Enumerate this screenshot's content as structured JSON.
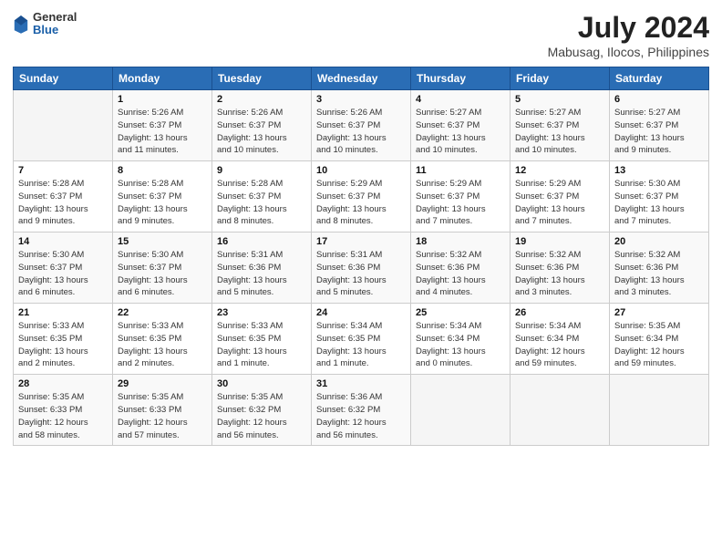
{
  "header": {
    "logo_general": "General",
    "logo_blue": "Blue",
    "month_year": "July 2024",
    "location": "Mabusag, Ilocos, Philippines"
  },
  "calendar": {
    "days_of_week": [
      "Sunday",
      "Monday",
      "Tuesday",
      "Wednesday",
      "Thursday",
      "Friday",
      "Saturday"
    ],
    "weeks": [
      [
        {
          "day": "",
          "info": ""
        },
        {
          "day": "1",
          "info": "Sunrise: 5:26 AM\nSunset: 6:37 PM\nDaylight: 13 hours\nand 11 minutes."
        },
        {
          "day": "2",
          "info": "Sunrise: 5:26 AM\nSunset: 6:37 PM\nDaylight: 13 hours\nand 10 minutes."
        },
        {
          "day": "3",
          "info": "Sunrise: 5:26 AM\nSunset: 6:37 PM\nDaylight: 13 hours\nand 10 minutes."
        },
        {
          "day": "4",
          "info": "Sunrise: 5:27 AM\nSunset: 6:37 PM\nDaylight: 13 hours\nand 10 minutes."
        },
        {
          "day": "5",
          "info": "Sunrise: 5:27 AM\nSunset: 6:37 PM\nDaylight: 13 hours\nand 10 minutes."
        },
        {
          "day": "6",
          "info": "Sunrise: 5:27 AM\nSunset: 6:37 PM\nDaylight: 13 hours\nand 9 minutes."
        }
      ],
      [
        {
          "day": "7",
          "info": "Sunrise: 5:28 AM\nSunset: 6:37 PM\nDaylight: 13 hours\nand 9 minutes."
        },
        {
          "day": "8",
          "info": "Sunrise: 5:28 AM\nSunset: 6:37 PM\nDaylight: 13 hours\nand 9 minutes."
        },
        {
          "day": "9",
          "info": "Sunrise: 5:28 AM\nSunset: 6:37 PM\nDaylight: 13 hours\nand 8 minutes."
        },
        {
          "day": "10",
          "info": "Sunrise: 5:29 AM\nSunset: 6:37 PM\nDaylight: 13 hours\nand 8 minutes."
        },
        {
          "day": "11",
          "info": "Sunrise: 5:29 AM\nSunset: 6:37 PM\nDaylight: 13 hours\nand 7 minutes."
        },
        {
          "day": "12",
          "info": "Sunrise: 5:29 AM\nSunset: 6:37 PM\nDaylight: 13 hours\nand 7 minutes."
        },
        {
          "day": "13",
          "info": "Sunrise: 5:30 AM\nSunset: 6:37 PM\nDaylight: 13 hours\nand 7 minutes."
        }
      ],
      [
        {
          "day": "14",
          "info": "Sunrise: 5:30 AM\nSunset: 6:37 PM\nDaylight: 13 hours\nand 6 minutes."
        },
        {
          "day": "15",
          "info": "Sunrise: 5:30 AM\nSunset: 6:37 PM\nDaylight: 13 hours\nand 6 minutes."
        },
        {
          "day": "16",
          "info": "Sunrise: 5:31 AM\nSunset: 6:36 PM\nDaylight: 13 hours\nand 5 minutes."
        },
        {
          "day": "17",
          "info": "Sunrise: 5:31 AM\nSunset: 6:36 PM\nDaylight: 13 hours\nand 5 minutes."
        },
        {
          "day": "18",
          "info": "Sunrise: 5:32 AM\nSunset: 6:36 PM\nDaylight: 13 hours\nand 4 minutes."
        },
        {
          "day": "19",
          "info": "Sunrise: 5:32 AM\nSunset: 6:36 PM\nDaylight: 13 hours\nand 3 minutes."
        },
        {
          "day": "20",
          "info": "Sunrise: 5:32 AM\nSunset: 6:36 PM\nDaylight: 13 hours\nand 3 minutes."
        }
      ],
      [
        {
          "day": "21",
          "info": "Sunrise: 5:33 AM\nSunset: 6:35 PM\nDaylight: 13 hours\nand 2 minutes."
        },
        {
          "day": "22",
          "info": "Sunrise: 5:33 AM\nSunset: 6:35 PM\nDaylight: 13 hours\nand 2 minutes."
        },
        {
          "day": "23",
          "info": "Sunrise: 5:33 AM\nSunset: 6:35 PM\nDaylight: 13 hours\nand 1 minute."
        },
        {
          "day": "24",
          "info": "Sunrise: 5:34 AM\nSunset: 6:35 PM\nDaylight: 13 hours\nand 1 minute."
        },
        {
          "day": "25",
          "info": "Sunrise: 5:34 AM\nSunset: 6:34 PM\nDaylight: 13 hours\nand 0 minutes."
        },
        {
          "day": "26",
          "info": "Sunrise: 5:34 AM\nSunset: 6:34 PM\nDaylight: 12 hours\nand 59 minutes."
        },
        {
          "day": "27",
          "info": "Sunrise: 5:35 AM\nSunset: 6:34 PM\nDaylight: 12 hours\nand 59 minutes."
        }
      ],
      [
        {
          "day": "28",
          "info": "Sunrise: 5:35 AM\nSunset: 6:33 PM\nDaylight: 12 hours\nand 58 minutes."
        },
        {
          "day": "29",
          "info": "Sunrise: 5:35 AM\nSunset: 6:33 PM\nDaylight: 12 hours\nand 57 minutes."
        },
        {
          "day": "30",
          "info": "Sunrise: 5:35 AM\nSunset: 6:32 PM\nDaylight: 12 hours\nand 56 minutes."
        },
        {
          "day": "31",
          "info": "Sunrise: 5:36 AM\nSunset: 6:32 PM\nDaylight: 12 hours\nand 56 minutes."
        },
        {
          "day": "",
          "info": ""
        },
        {
          "day": "",
          "info": ""
        },
        {
          "day": "",
          "info": ""
        }
      ]
    ]
  }
}
